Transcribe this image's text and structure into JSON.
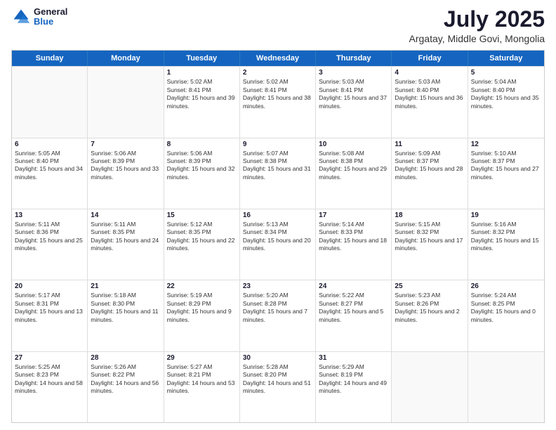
{
  "header": {
    "logo": {
      "general": "General",
      "blue": "Blue"
    },
    "title": "July 2025",
    "subtitle": "Argatay, Middle Govi, Mongolia"
  },
  "weekdays": [
    "Sunday",
    "Monday",
    "Tuesday",
    "Wednesday",
    "Thursday",
    "Friday",
    "Saturday"
  ],
  "weeks": [
    [
      {
        "day": "",
        "empty": true
      },
      {
        "day": "",
        "empty": true
      },
      {
        "day": "1",
        "sunrise": "5:02 AM",
        "sunset": "8:41 PM",
        "daylight": "15 hours and 39 minutes."
      },
      {
        "day": "2",
        "sunrise": "5:02 AM",
        "sunset": "8:41 PM",
        "daylight": "15 hours and 38 minutes."
      },
      {
        "day": "3",
        "sunrise": "5:03 AM",
        "sunset": "8:41 PM",
        "daylight": "15 hours and 37 minutes."
      },
      {
        "day": "4",
        "sunrise": "5:03 AM",
        "sunset": "8:40 PM",
        "daylight": "15 hours and 36 minutes."
      },
      {
        "day": "5",
        "sunrise": "5:04 AM",
        "sunset": "8:40 PM",
        "daylight": "15 hours and 35 minutes."
      }
    ],
    [
      {
        "day": "6",
        "sunrise": "5:05 AM",
        "sunset": "8:40 PM",
        "daylight": "15 hours and 34 minutes."
      },
      {
        "day": "7",
        "sunrise": "5:06 AM",
        "sunset": "8:39 PM",
        "daylight": "15 hours and 33 minutes."
      },
      {
        "day": "8",
        "sunrise": "5:06 AM",
        "sunset": "8:39 PM",
        "daylight": "15 hours and 32 minutes."
      },
      {
        "day": "9",
        "sunrise": "5:07 AM",
        "sunset": "8:38 PM",
        "daylight": "15 hours and 31 minutes."
      },
      {
        "day": "10",
        "sunrise": "5:08 AM",
        "sunset": "8:38 PM",
        "daylight": "15 hours and 29 minutes."
      },
      {
        "day": "11",
        "sunrise": "5:09 AM",
        "sunset": "8:37 PM",
        "daylight": "15 hours and 28 minutes."
      },
      {
        "day": "12",
        "sunrise": "5:10 AM",
        "sunset": "8:37 PM",
        "daylight": "15 hours and 27 minutes."
      }
    ],
    [
      {
        "day": "13",
        "sunrise": "5:11 AM",
        "sunset": "8:36 PM",
        "daylight": "15 hours and 25 minutes."
      },
      {
        "day": "14",
        "sunrise": "5:11 AM",
        "sunset": "8:35 PM",
        "daylight": "15 hours and 24 minutes."
      },
      {
        "day": "15",
        "sunrise": "5:12 AM",
        "sunset": "8:35 PM",
        "daylight": "15 hours and 22 minutes."
      },
      {
        "day": "16",
        "sunrise": "5:13 AM",
        "sunset": "8:34 PM",
        "daylight": "15 hours and 20 minutes."
      },
      {
        "day": "17",
        "sunrise": "5:14 AM",
        "sunset": "8:33 PM",
        "daylight": "15 hours and 18 minutes."
      },
      {
        "day": "18",
        "sunrise": "5:15 AM",
        "sunset": "8:32 PM",
        "daylight": "15 hours and 17 minutes."
      },
      {
        "day": "19",
        "sunrise": "5:16 AM",
        "sunset": "8:32 PM",
        "daylight": "15 hours and 15 minutes."
      }
    ],
    [
      {
        "day": "20",
        "sunrise": "5:17 AM",
        "sunset": "8:31 PM",
        "daylight": "15 hours and 13 minutes."
      },
      {
        "day": "21",
        "sunrise": "5:18 AM",
        "sunset": "8:30 PM",
        "daylight": "15 hours and 11 minutes."
      },
      {
        "day": "22",
        "sunrise": "5:19 AM",
        "sunset": "8:29 PM",
        "daylight": "15 hours and 9 minutes."
      },
      {
        "day": "23",
        "sunrise": "5:20 AM",
        "sunset": "8:28 PM",
        "daylight": "15 hours and 7 minutes."
      },
      {
        "day": "24",
        "sunrise": "5:22 AM",
        "sunset": "8:27 PM",
        "daylight": "15 hours and 5 minutes."
      },
      {
        "day": "25",
        "sunrise": "5:23 AM",
        "sunset": "8:26 PM",
        "daylight": "15 hours and 2 minutes."
      },
      {
        "day": "26",
        "sunrise": "5:24 AM",
        "sunset": "8:25 PM",
        "daylight": "15 hours and 0 minutes."
      }
    ],
    [
      {
        "day": "27",
        "sunrise": "5:25 AM",
        "sunset": "8:23 PM",
        "daylight": "14 hours and 58 minutes."
      },
      {
        "day": "28",
        "sunrise": "5:26 AM",
        "sunset": "8:22 PM",
        "daylight": "14 hours and 56 minutes."
      },
      {
        "day": "29",
        "sunrise": "5:27 AM",
        "sunset": "8:21 PM",
        "daylight": "14 hours and 53 minutes."
      },
      {
        "day": "30",
        "sunrise": "5:28 AM",
        "sunset": "8:20 PM",
        "daylight": "14 hours and 51 minutes."
      },
      {
        "day": "31",
        "sunrise": "5:29 AM",
        "sunset": "8:19 PM",
        "daylight": "14 hours and 49 minutes."
      },
      {
        "day": "",
        "empty": true
      },
      {
        "day": "",
        "empty": true
      }
    ]
  ],
  "labels": {
    "sunrise": "Sunrise:",
    "sunset": "Sunset:",
    "daylight": "Daylight:"
  }
}
